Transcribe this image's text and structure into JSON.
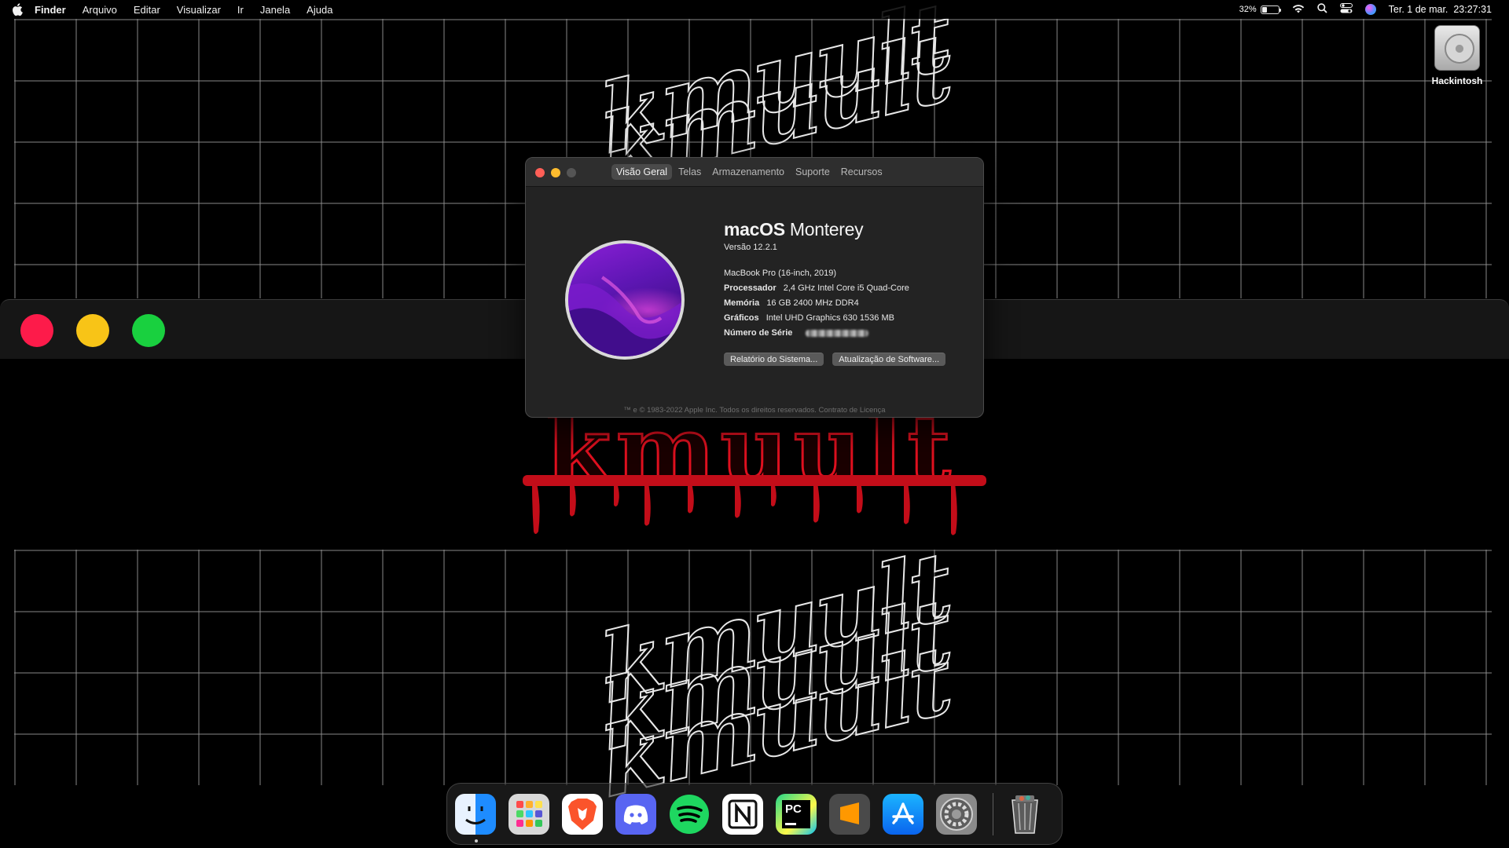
{
  "menubar": {
    "apple_icon": "apple-icon",
    "app_name": "Finder",
    "items": [
      "Arquivo",
      "Editar",
      "Visualizar",
      "Ir",
      "Janela",
      "Ajuda"
    ],
    "battery_percent": "32%",
    "battery_level": 0.32,
    "datetime": "Ter. 1 de mar.  23:27:31",
    "status_icons": [
      "battery-icon",
      "wifi-icon",
      "search-icon",
      "control-center-icon",
      "siri-icon"
    ]
  },
  "desktop": {
    "icons": [
      {
        "label": "Hackintosh",
        "icon": "hard-drive-icon"
      }
    ],
    "wallpaper_word": "kmuult"
  },
  "about_window": {
    "tabs": [
      "Visão Geral",
      "Telas",
      "Armazenamento",
      "Suporte",
      "Recursos"
    ],
    "active_tab": "Visão Geral",
    "os_name_bold": "macOS",
    "os_name_light": "Monterey",
    "version": "Versão 12.2.1",
    "model": "MacBook Pro (16-inch, 2019)",
    "specs": [
      {
        "key": "Processador",
        "value": "2,4 GHz Intel Core i5 Quad-Core"
      },
      {
        "key": "Memória",
        "value": "16 GB 2400 MHz DDR4"
      },
      {
        "key": "Gráficos",
        "value": "Intel UHD Graphics 630 1536 MB"
      },
      {
        "key": "Número de Série",
        "value": ""
      }
    ],
    "buttons": [
      "Relatório do Sistema...",
      "Atualização de Software..."
    ],
    "footer": "™ e © 1983-2022 Apple Inc. Todos os direitos reservados. Contrato de Licença"
  },
  "dock": {
    "apps": [
      "Finder",
      "Launchpad",
      "Brave",
      "Discord",
      "Spotify",
      "Notion",
      "PyCharm",
      "Sublime Text",
      "App Store",
      "Preferências do Sistema"
    ],
    "trash": "Lixo"
  },
  "colors": {
    "traffic_red": "#fd1b4a",
    "traffic_yellow": "#f8c417",
    "traffic_green": "#19d03f",
    "blood": "#d10f1b"
  }
}
